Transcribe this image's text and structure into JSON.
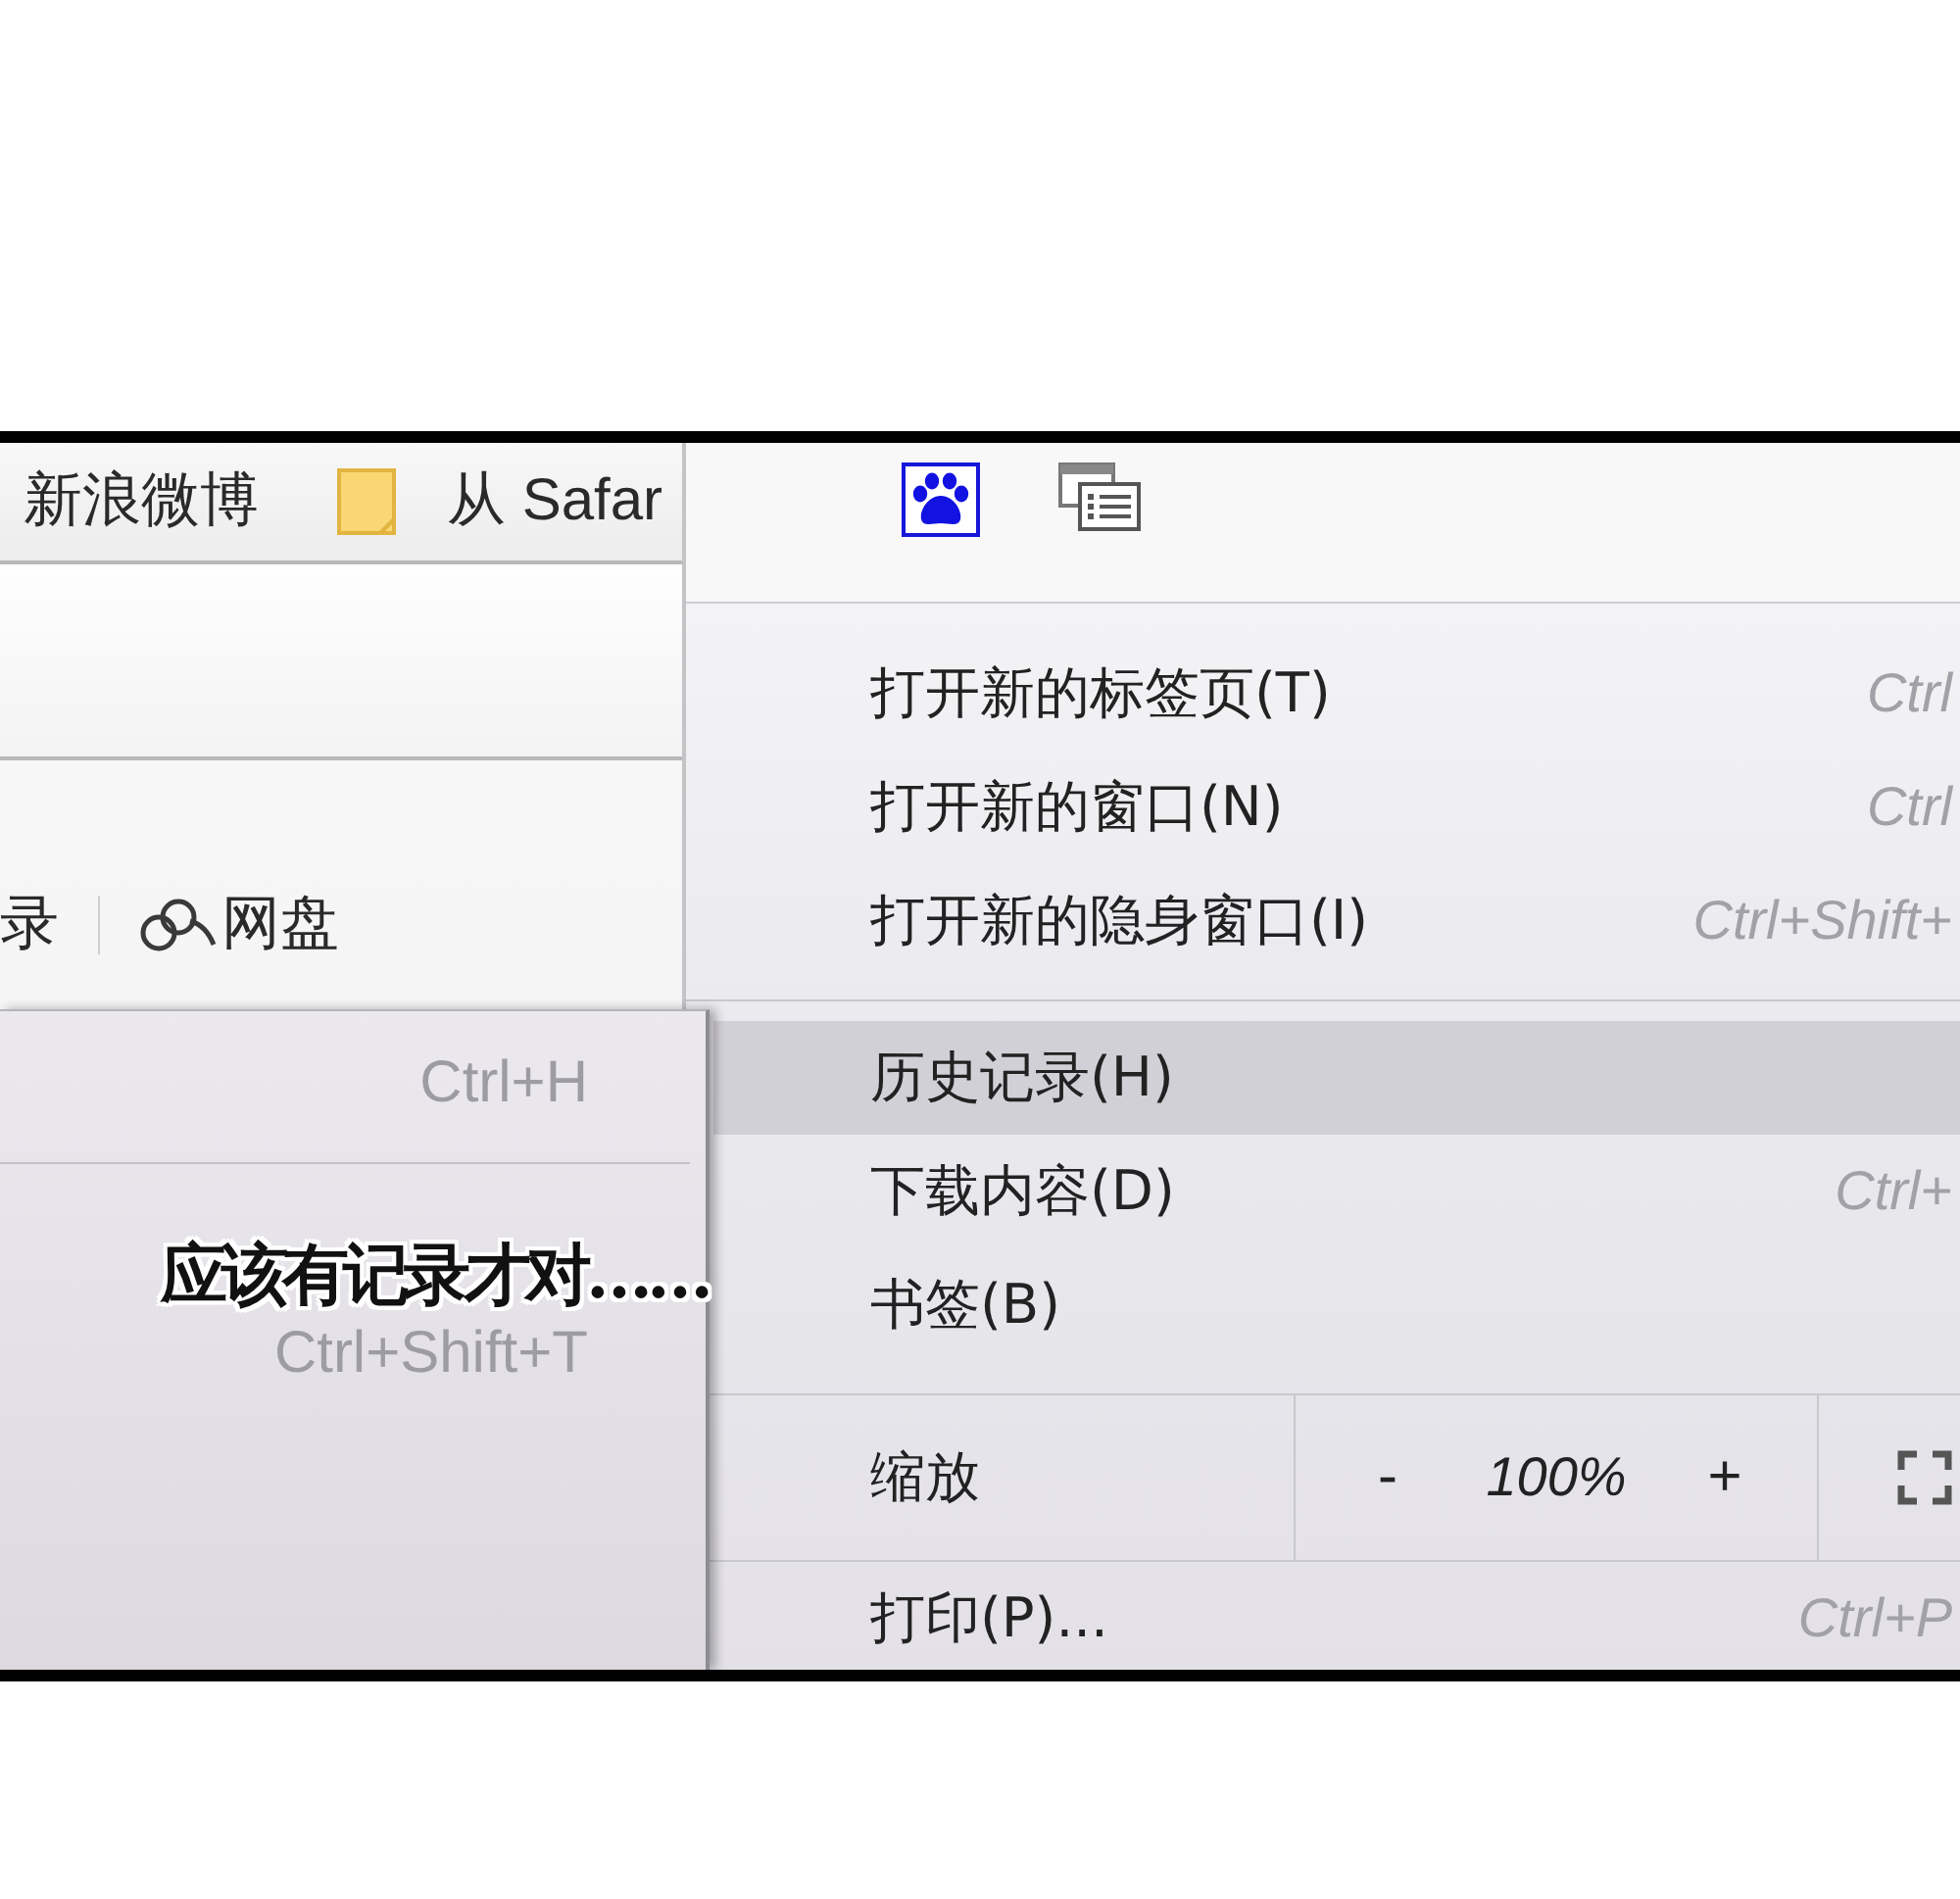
{
  "bookmarks_bar": {
    "items": [
      {
        "kind": "link",
        "label": "新浪微博"
      },
      {
        "kind": "folder",
        "label": "从 Safar"
      }
    ]
  },
  "toolbar": {
    "items": [
      {
        "kind": "link",
        "label": "录"
      },
      {
        "kind": "cloud",
        "label": "网盘"
      }
    ]
  },
  "menu": {
    "items": [
      {
        "kind": "item",
        "label": "打开新的标签页(T)",
        "shortcut": "Ctrl",
        "selected": false
      },
      {
        "kind": "item",
        "label": "打开新的窗口(N)",
        "shortcut": "Ctrl",
        "selected": false
      },
      {
        "kind": "item",
        "label": "打开新的隐身窗口(I)",
        "shortcut": "Ctrl+Shift+",
        "selected": false
      },
      {
        "kind": "separator"
      },
      {
        "kind": "item",
        "label": "历史记录(H)",
        "selected": true
      },
      {
        "kind": "item",
        "label": "下载内容(D)",
        "shortcut": "Ctrl+",
        "selected": false
      },
      {
        "kind": "item",
        "label": "书签(B)",
        "selected": false
      },
      {
        "kind": "zoom",
        "label": "缩放",
        "minus": "-",
        "value": "100%",
        "plus": "+"
      },
      {
        "kind": "item",
        "label": "打印(P)...",
        "shortcut": "Ctrl+P",
        "selected": false
      }
    ]
  },
  "submenu": {
    "items": [
      {
        "kind": "item",
        "shortcut": "Ctrl+H"
      },
      {
        "kind": "separator"
      },
      {
        "kind": "item",
        "shortcut": "Ctrl+Shift+T"
      }
    ]
  },
  "caption": {
    "text": "应该有记录才对……"
  }
}
